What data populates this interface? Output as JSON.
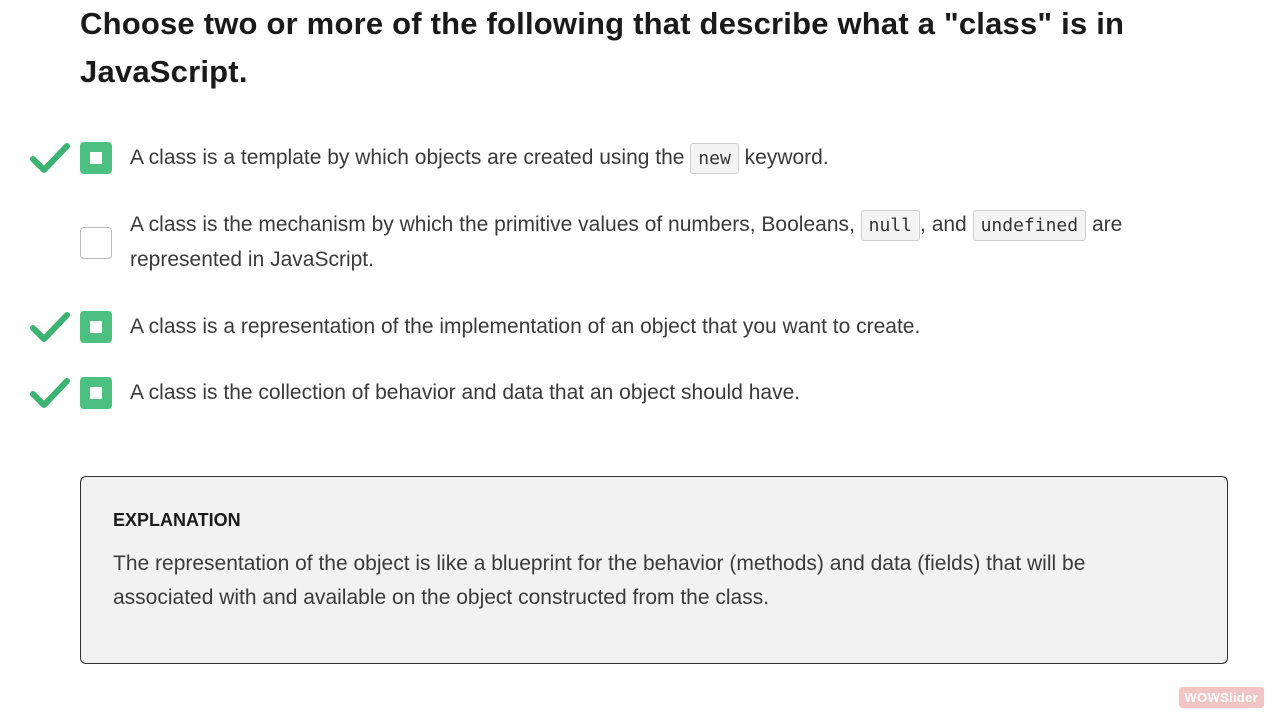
{
  "question": {
    "title": "Choose two or more of the following that describe what a \"class\" is in JavaScript."
  },
  "options": [
    {
      "checked": true,
      "correct": true,
      "text_before": "A class is a template by which objects are created using the ",
      "code_1": "new",
      "text_after": " keyword."
    },
    {
      "checked": false,
      "correct": false,
      "text_before": "A class is the mechanism by which the primitive values of numbers, Booleans, ",
      "code_1": "null",
      "text_middle": ", and ",
      "code_2": "undefined",
      "text_after": " are represented in JavaScript."
    },
    {
      "checked": true,
      "correct": true,
      "text": "A class is a representation of the implementation of an object that you want to create."
    },
    {
      "checked": true,
      "correct": true,
      "text": "A class is the collection of behavior and data that an object should have."
    }
  ],
  "explanation": {
    "heading": "EXPLANATION",
    "body": "The representation of the object is like a blueprint for the behavior (methods) and data (fields) that will be associated with and available on the object constructed from the class."
  },
  "badge": {
    "label": "WOWSlider"
  },
  "colors": {
    "accent_green": "#4cc081",
    "check_green": "#3cb371"
  },
  "icons": {
    "correct": "check-mark-icon",
    "selected": "checked-checkbox-icon",
    "unselected": "empty-checkbox-icon"
  }
}
